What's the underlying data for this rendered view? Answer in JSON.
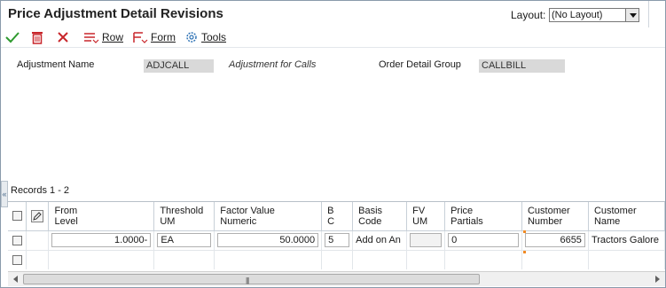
{
  "header": {
    "title": "Price Adjustment Detail Revisions",
    "layout_label": "Layout:",
    "layout_value": "(No Layout)"
  },
  "toolbar": {
    "ok_icon": "checkmark-icon",
    "delete_icon": "trash-icon",
    "cancel_icon": "x-icon",
    "row_label": "Row",
    "form_label": "Form",
    "tools_label": "Tools"
  },
  "form": {
    "adjustment_name_label": "Adjustment Name",
    "adjustment_name_value": "ADJCALL",
    "adjustment_description": "Adjustment for Calls",
    "order_detail_group_label": "Order Detail Group",
    "order_detail_group_value": "CALLBILL"
  },
  "grid": {
    "records_label": "Records 1 - 2",
    "columns": [
      {
        "line1": "From",
        "line2": "Level"
      },
      {
        "line1": "Threshold",
        "line2": "UM"
      },
      {
        "line1": "Factor Value",
        "line2": "Numeric"
      },
      {
        "line1": "B",
        "line2": "C"
      },
      {
        "line1": "Basis",
        "line2": "Code"
      },
      {
        "line1": "FV",
        "line2": "UM"
      },
      {
        "line1": "Price",
        "line2": "Partials"
      },
      {
        "line1": "Customer",
        "line2": "Number"
      },
      {
        "line1": "Customer",
        "line2": "Name"
      }
    ],
    "rows": [
      {
        "from_level": "1.0000-",
        "threshold_um": "EA",
        "factor_value": "50.0000",
        "bc": "5",
        "basis_code": "Add on An",
        "fv_um": "",
        "price_partials": "0",
        "customer_number": "6655",
        "customer_name": "Tractors Galore"
      }
    ]
  },
  "colors": {
    "accent_green": "#2e9a2e",
    "delete_red": "#c8262b",
    "border": "#8a9aab",
    "readonly_field": "#d9d9d9",
    "selection_marker": "#f08a24"
  }
}
